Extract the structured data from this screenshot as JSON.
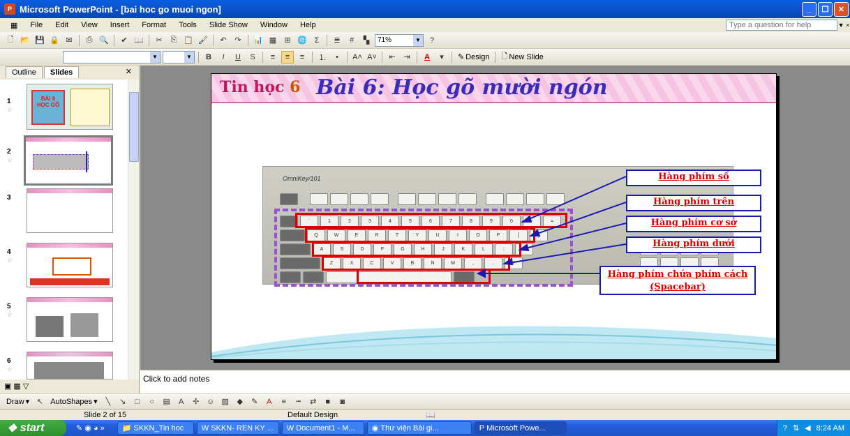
{
  "window": {
    "title": "Microsoft PowerPoint - [bai hoc go muoi ngon]"
  },
  "menu": {
    "items": [
      "File",
      "Edit",
      "View",
      "Insert",
      "Format",
      "Tools",
      "Slide Show",
      "Window",
      "Help"
    ],
    "help_placeholder": "Type a question for help"
  },
  "toolbar": {
    "zoom": "71%",
    "design_label": "Design",
    "new_slide_label": "New Slide"
  },
  "left_pane": {
    "tabs": [
      "Outline",
      "Slides"
    ],
    "active_tab": "Slides",
    "slide_numbers": [
      "1",
      "2",
      "3",
      "4",
      "5",
      "6"
    ]
  },
  "slide": {
    "tag_text": "Tin học",
    "tag_num": "6",
    "title": "Bài 6: Học gõ mười ngón",
    "brand": "OmniKey/101",
    "labels": [
      "Hàng phím số",
      "Hàng phím trên",
      "Hàng phím cơ sở",
      "Hàng phím dưới",
      "Hàng phím chứa phím cách (Spacebar)"
    ],
    "keys_row1": [
      "`",
      "1",
      "2",
      "3",
      "4",
      "5",
      "6",
      "7",
      "8",
      "9",
      "0",
      "-",
      "="
    ],
    "keys_row2": [
      "Q",
      "W",
      "E",
      "R",
      "T",
      "Y",
      "U",
      "I",
      "O",
      "P",
      "[",
      "]"
    ],
    "keys_row3": [
      "A",
      "S",
      "D",
      "F",
      "G",
      "H",
      "J",
      "K",
      "L",
      ";",
      "'"
    ],
    "keys_row4": [
      "Z",
      "X",
      "C",
      "V",
      "B",
      "N",
      "M",
      ",",
      ".",
      "/"
    ]
  },
  "notes": {
    "placeholder": "Click to add notes"
  },
  "drawbar": {
    "draw_label": "Draw",
    "autoshapes_label": "AutoShapes"
  },
  "status": {
    "slide": "Slide 2 of 15",
    "design": "Default Design"
  },
  "taskbar": {
    "start": "start",
    "tasks": [
      "SKKN_Tin hoc",
      "SKKN- REN KY ...",
      "Document1 - M...",
      "Thư viện Bài gi...",
      "Microsoft Powe..."
    ],
    "time": "8:24 AM"
  }
}
